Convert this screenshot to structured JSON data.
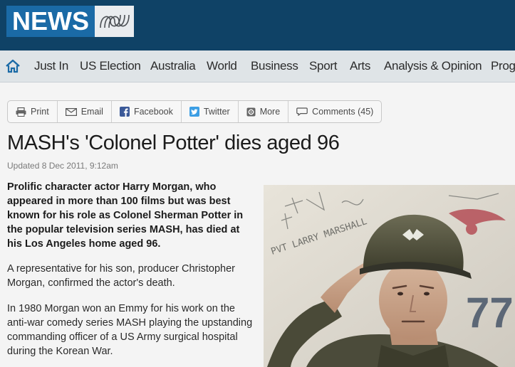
{
  "masthead": {
    "logo_text": "NEWS",
    "logo_color": "#1a6aa6",
    "bar_color": "#0f4266"
  },
  "nav": {
    "home_icon": "home-icon",
    "items": [
      "Just In",
      "US Election",
      "Australia",
      "World",
      "Business",
      "Sport",
      "Arts",
      "Analysis & Opinion",
      "Prog"
    ]
  },
  "share": {
    "print": "Print",
    "email": "Email",
    "facebook": "Facebook",
    "twitter": "Twitter",
    "more": "More",
    "comments": "Comments (45)"
  },
  "article": {
    "headline": "MASH's 'Colonel Potter' dies aged 96",
    "updated": "Updated 8 Dec 2011, 9:12am",
    "lede": "Prolific character actor Harry Morgan, who appeared in more than 100 films but was best known for his role as Colonel Sherman Potter in the popular television series MASH, has died at his Los Angeles home aged 96.",
    "p2": "A representative for his son, producer Christopher Morgan, confirmed the actor's death.",
    "p3": "In 1980 Morgan won an Emmy for his work on the anti-war comedy series MASH playing the upstanding commanding officer of a US Army surgical hospital during the Korean War."
  },
  "photo": {
    "wall_text": "PVT LARRY MARSHALL",
    "number_text": "77"
  }
}
